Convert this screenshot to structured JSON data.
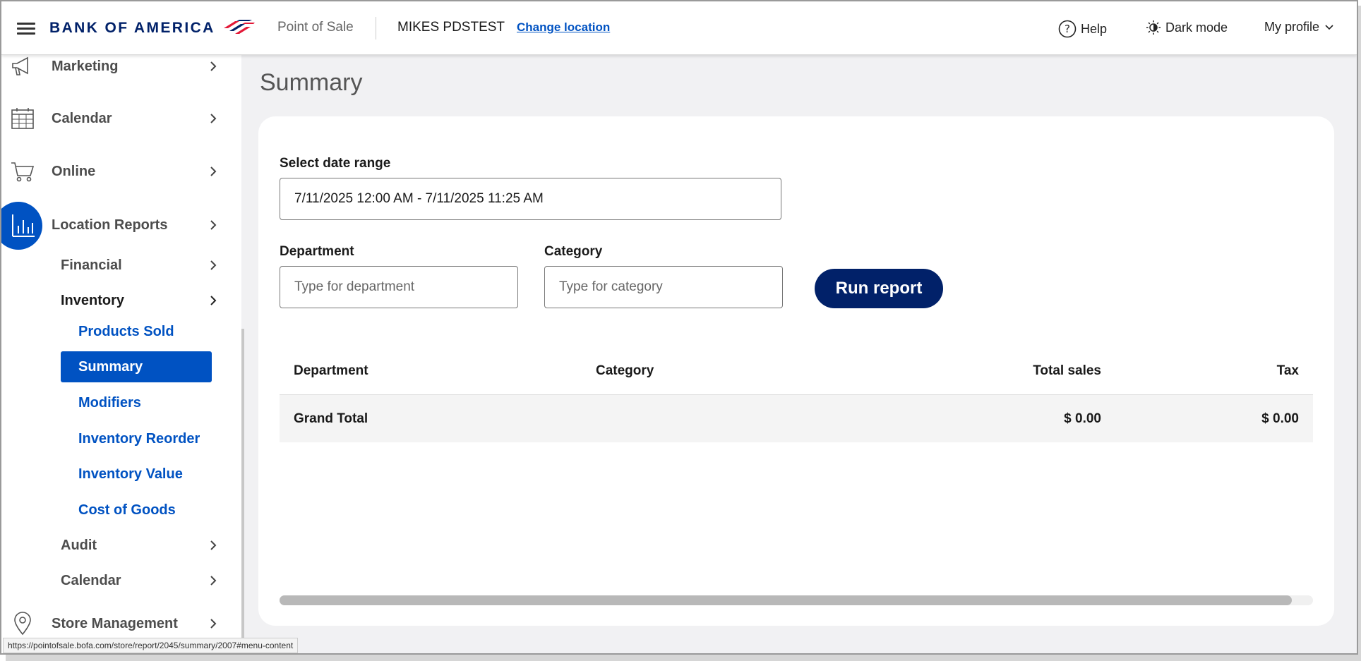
{
  "header": {
    "brand": "BANK OF AMERICA",
    "app_name": "Point of Sale",
    "store_name": "MIKES PDSTEST",
    "change_location": "Change location",
    "help": "Help",
    "dark_mode": "Dark mode",
    "profile": "My profile"
  },
  "sidebar": {
    "items": [
      {
        "label": "Marketing",
        "icon": "megaphone-icon"
      },
      {
        "label": "Calendar",
        "icon": "calendar-icon"
      },
      {
        "label": "Online",
        "icon": "cart-icon"
      },
      {
        "label": "Location Reports",
        "icon": "bar-chart-icon"
      },
      {
        "label": "Store Management",
        "icon": "location-pin-icon"
      }
    ],
    "report_sections": {
      "financial": "Financial",
      "inventory": "Inventory",
      "audit": "Audit",
      "calendar": "Calendar"
    },
    "inventory_links": [
      "Products Sold",
      "Summary",
      "Modifiers",
      "Inventory Reorder",
      "Inventory Value",
      "Cost of Goods"
    ],
    "selected": "Summary"
  },
  "main": {
    "title": "Summary",
    "date_range_label": "Select date range",
    "date_range_value": "7/11/2025 12:00 AM - 7/11/2025 11:25 AM",
    "department_label": "Department",
    "department_placeholder": "Type for department",
    "category_label": "Category",
    "category_placeholder": "Type for category",
    "run_report": "Run report",
    "table": {
      "columns": [
        "Department",
        "Category",
        "Total sales",
        "Tax"
      ],
      "grand_total_label": "Grand Total",
      "grand_total_sales": "$ 0.00",
      "grand_total_tax": "$ 0.00"
    }
  },
  "status_bar_url": "https://pointofsale.bofa.com/store/report/2045/summary/2007#menu-content",
  "colors": {
    "brand_navy": "#012169",
    "accent_blue": "#0052c2",
    "brand_red": "#e31837"
  }
}
